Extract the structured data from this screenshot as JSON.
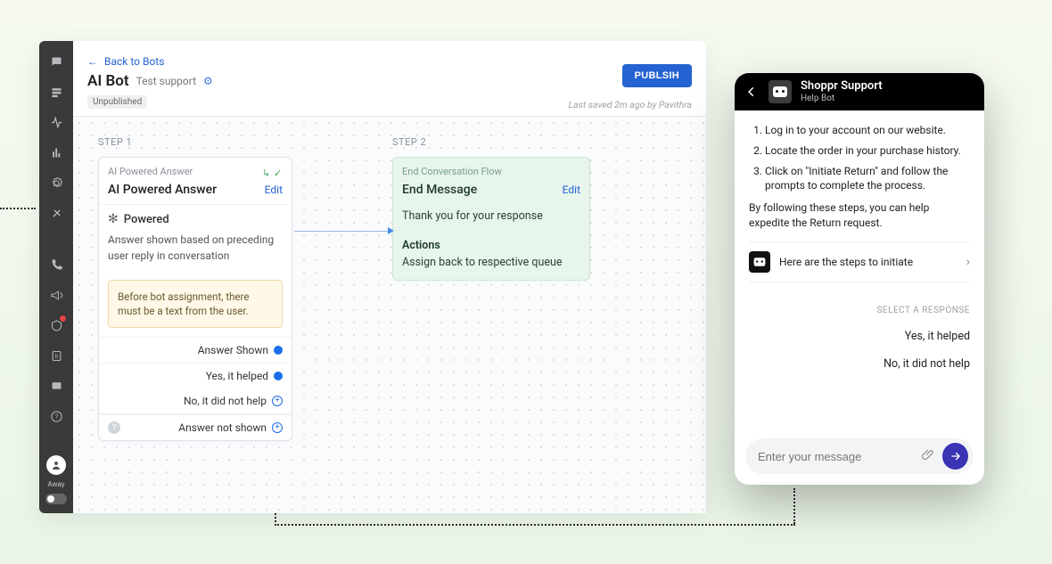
{
  "header": {
    "back_label": "Back to Bots",
    "title": "AI Bot",
    "subtitle": "Test support",
    "status_pill": "Unpublished",
    "publish_btn": "PUBLSIH",
    "last_saved": "Last saved 2m ago by Pavithra"
  },
  "sidebar": {
    "status_label": "Away"
  },
  "canvas": {
    "step1_label": "STEP 1",
    "step2_label": "STEP 2",
    "card1": {
      "eyebrow": "AI Powered Answer",
      "title": "AI Powered Answer",
      "edit": "Edit",
      "powered": "Powered",
      "desc": "Answer shown based on preceding user reply in conversation",
      "notice": "Before bot assignment, there must be a text from the user.",
      "branch_shown": "Answer Shown",
      "branch_yes": "Yes, it helped",
      "branch_no": "No, it did not help",
      "branch_notshown": "Answer not shown"
    },
    "card2": {
      "eyebrow": "End Conversation Flow",
      "title": "End Message",
      "edit": "Edit",
      "body": "Thank you for your response",
      "actions_h": "Actions",
      "actions_d": "Assign back to respective queue"
    }
  },
  "phone": {
    "title": "Shoppr Support",
    "subtitle": "Help Bot",
    "steps": [
      "Log in to your account on our website.",
      "Locate the order in your purchase history.",
      "Click on \"Initiate Return\" and follow the prompts to complete the process."
    ],
    "followup": "By following these steps, you can help expedite the Return request.",
    "row_text": "Here are the steps to initiate",
    "select_label": "SELECT A RESPONSE",
    "opt_yes": "Yes, it helped",
    "opt_no": "No, it did not help",
    "placeholder": "Enter your message"
  }
}
